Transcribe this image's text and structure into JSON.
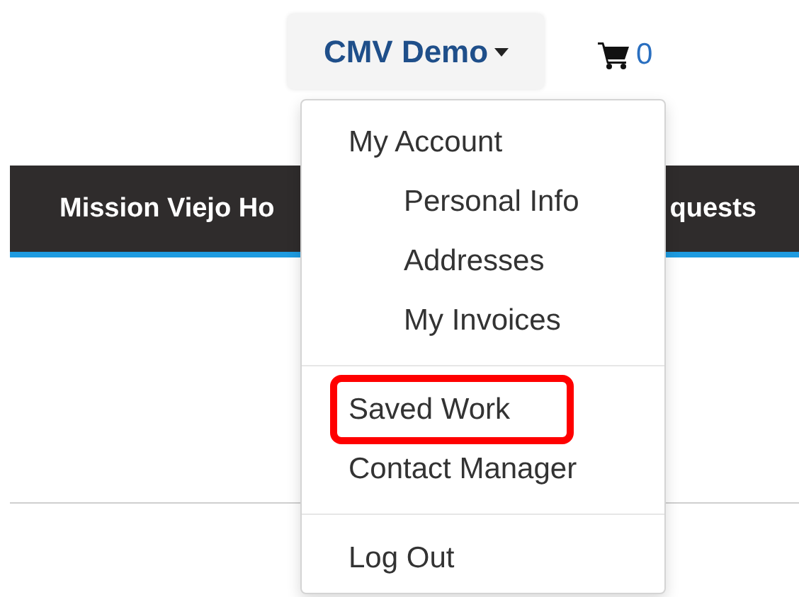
{
  "account_button": {
    "label": "CMV Demo",
    "expanded": true
  },
  "cart": {
    "count": "0"
  },
  "nav_bar": {
    "items": [
      "Mission Viejo Ho",
      "quests"
    ]
  },
  "menu": {
    "sections": [
      {
        "items": [
          {
            "label": "My Account",
            "highlighted": false,
            "children": [
              {
                "label": "Personal Info",
                "highlighted": false
              },
              {
                "label": "Addresses",
                "highlighted": false
              },
              {
                "label": "My Invoices",
                "highlighted": false
              }
            ]
          }
        ]
      },
      {
        "items": [
          {
            "label": "Saved Work",
            "highlighted": true
          },
          {
            "label": "Contact Manager",
            "highlighted": false
          }
        ]
      },
      {
        "items": [
          {
            "label": "Log Out",
            "highlighted": false
          }
        ]
      }
    ]
  }
}
